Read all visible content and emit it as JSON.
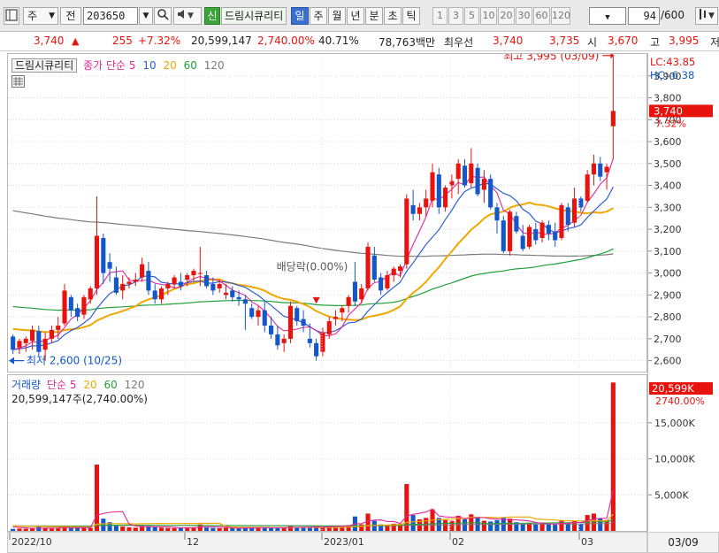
{
  "toolbar": {
    "period_select": "주",
    "prev_label": "전",
    "code": "203650",
    "new_badge": "신",
    "stock_name": "드림시큐리티",
    "tabs": [
      "일",
      "주",
      "월",
      "년",
      "분",
      "초",
      "틱"
    ],
    "active_tab": "일",
    "intervals": [
      "1",
      "3",
      "5",
      "10",
      "20",
      "30",
      "60",
      "120"
    ],
    "count": "94",
    "count_total": "/600"
  },
  "quote": {
    "price": "3,740",
    "change_arrow": "▲",
    "change": "255",
    "change_pct": "+7.32%",
    "volume": "20,599,147",
    "volume_ratio": "2,740.00%",
    "turnover_pct": "40.71%",
    "trade_value": "78,763백만",
    "priority_label": "최우선",
    "ask": "3,740",
    "bid": "3,735",
    "open_label": "시",
    "open": "3,670",
    "high_label": "고",
    "high": "3,995",
    "cut_label": "저"
  },
  "price_legend": {
    "name": "드림시큐리티",
    "ma_title": "종가 단순",
    "ma_periods": [
      "5",
      "10",
      "20",
      "60",
      "120"
    ]
  },
  "volume_legend": {
    "name": "거래량",
    "ma_title": "단순",
    "ma_periods": [
      "5",
      "20",
      "60",
      "120"
    ],
    "current": "20,599,147주(2,740.00%)"
  },
  "price_axis": {
    "lc": "LC:43.85",
    "hc": "HC:-6.38",
    "current_tag": "3,740",
    "current_pct": "7.32%",
    "ticks": [
      "3,900",
      "3,800",
      "3,700",
      "3,600",
      "3,500",
      "3,400",
      "3,300",
      "3,200",
      "3,100",
      "3,000",
      "2,900",
      "2,800",
      "2,700",
      "2,600"
    ]
  },
  "volume_axis": {
    "current_tag": "20,599K",
    "current_pct": "2740.00%",
    "ticks": [
      "15,000K",
      "10,000K",
      "5,000K"
    ]
  },
  "x_axis": {
    "labels": [
      "2022/10",
      "12",
      "2023/01",
      "02",
      "03"
    ],
    "current_date": "03/09"
  },
  "annotations": {
    "high": "최고 3,995 (03/09)",
    "low": "최저 2,600 (10/25)",
    "dividend": "배당락(0.00%)"
  },
  "colors": {
    "up": "#e8130d",
    "down": "#1357c9",
    "ma5": "#e0289a",
    "ma10": "#2e5fd0",
    "ma20": "#f0a800",
    "ma60": "#22a03a",
    "ma120": "#7b7b7b",
    "vma5": "#e0289a",
    "vma20": "#f0a800",
    "vma60": "#22a03a",
    "vma120": "#7b7b7b"
  },
  "chart_data": {
    "type": "candlestick",
    "ylim": [
      2550,
      4000
    ],
    "volume_ylim": [
      0,
      21000
    ],
    "volume_unit": "K shares",
    "ohlc": [
      [
        2710,
        2720,
        2630,
        2650
      ],
      [
        2660,
        2700,
        2630,
        2690
      ],
      [
        2680,
        2710,
        2640,
        2700
      ],
      [
        2690,
        2760,
        2650,
        2740
      ],
      [
        2735,
        2760,
        2620,
        2640
      ],
      [
        2650,
        2730,
        2600,
        2700
      ],
      [
        2700,
        2760,
        2680,
        2740
      ],
      [
        2740,
        2800,
        2700,
        2760
      ],
      [
        2770,
        2950,
        2760,
        2920
      ],
      [
        2890,
        2900,
        2800,
        2830
      ],
      [
        2840,
        2860,
        2780,
        2800
      ],
      [
        2810,
        2900,
        2790,
        2890
      ],
      [
        2880,
        2940,
        2860,
        2930
      ],
      [
        2930,
        3350,
        2900,
        3170
      ],
      [
        3160,
        3180,
        2950,
        3000
      ],
      [
        3050,
        3090,
        2960,
        3020
      ],
      [
        2980,
        3030,
        2900,
        2910
      ],
      [
        2920,
        2990,
        2880,
        2950
      ],
      [
        2950,
        2980,
        2930,
        2960
      ],
      [
        2960,
        3000,
        2940,
        2970
      ],
      [
        2980,
        3070,
        2960,
        3040
      ],
      [
        3010,
        3050,
        2900,
        2920
      ],
      [
        2920,
        2950,
        2860,
        2880
      ],
      [
        2880,
        2940,
        2860,
        2930
      ],
      [
        2930,
        2960,
        2900,
        2950
      ],
      [
        2950,
        2990,
        2930,
        2980
      ],
      [
        2960,
        3000,
        2920,
        2940
      ],
      [
        2970,
        3000,
        2940,
        2990
      ],
      [
        2990,
        3020,
        2960,
        3010
      ],
      [
        3000,
        3120,
        2940,
        3000
      ],
      [
        2990,
        3010,
        2930,
        2940
      ],
      [
        2950,
        2980,
        2900,
        2920
      ],
      [
        2930,
        2970,
        2910,
        2950
      ],
      [
        2900,
        2950,
        2880,
        2910
      ],
      [
        2920,
        2940,
        2870,
        2890
      ],
      [
        2890,
        2920,
        2850,
        2880
      ],
      [
        2880,
        2900,
        2740,
        2860
      ],
      [
        2840,
        2860,
        2790,
        2800
      ],
      [
        2800,
        2850,
        2760,
        2830
      ],
      [
        2830,
        2870,
        2730,
        2760
      ],
      [
        2760,
        2800,
        2700,
        2720
      ],
      [
        2720,
        2760,
        2650,
        2670
      ],
      [
        2680,
        2720,
        2640,
        2700
      ],
      [
        2700,
        2870,
        2680,
        2850
      ],
      [
        2840,
        2850,
        2760,
        2780
      ],
      [
        2790,
        2830,
        2730,
        2760
      ],
      [
        2700,
        2770,
        2660,
        2680
      ],
      [
        2680,
        2700,
        2600,
        2620
      ],
      [
        2640,
        2750,
        2620,
        2730
      ],
      [
        2720,
        2800,
        2700,
        2780
      ],
      [
        2790,
        2830,
        2760,
        2800
      ],
      [
        2820,
        2850,
        2780,
        2840
      ],
      [
        2850,
        2900,
        2820,
        2890
      ],
      [
        2960,
        3050,
        2850,
        2870
      ],
      [
        2880,
        2950,
        2860,
        2930
      ],
      [
        2930,
        3140,
        2920,
        3120
      ],
      [
        3080,
        3120,
        2960,
        2970
      ],
      [
        2980,
        3000,
        2900,
        2920
      ],
      [
        2930,
        3010,
        2920,
        2990
      ],
      [
        2990,
        3030,
        2960,
        3020
      ],
      [
        3010,
        3040,
        2980,
        3030
      ],
      [
        3040,
        3360,
        3020,
        3340
      ],
      [
        3310,
        3380,
        3240,
        3270
      ],
      [
        3270,
        3320,
        3240,
        3300
      ],
      [
        3300,
        3380,
        3260,
        3340
      ],
      [
        3330,
        3500,
        3300,
        3460
      ],
      [
        3450,
        3480,
        3270,
        3300
      ],
      [
        3300,
        3400,
        3280,
        3390
      ],
      [
        3400,
        3450,
        3340,
        3420
      ],
      [
        3430,
        3520,
        3360,
        3500
      ],
      [
        3490,
        3520,
        3390,
        3400
      ],
      [
        3410,
        3570,
        3390,
        3500
      ],
      [
        3480,
        3500,
        3350,
        3360
      ],
      [
        3380,
        3470,
        3320,
        3430
      ],
      [
        3430,
        3450,
        3290,
        3300
      ],
      [
        3300,
        3320,
        3180,
        3240
      ],
      [
        3240,
        3260,
        3090,
        3100
      ],
      [
        3100,
        3290,
        3080,
        3280
      ],
      [
        3260,
        3280,
        3180,
        3190
      ],
      [
        3170,
        3220,
        3100,
        3110
      ],
      [
        3120,
        3220,
        3110,
        3210
      ],
      [
        3200,
        3230,
        3130,
        3150
      ],
      [
        3160,
        3240,
        3140,
        3230
      ],
      [
        3220,
        3240,
        3150,
        3180
      ],
      [
        3190,
        3230,
        3120,
        3150
      ],
      [
        3160,
        3320,
        3150,
        3310
      ],
      [
        3300,
        3320,
        3190,
        3220
      ],
      [
        3230,
        3390,
        3210,
        3340
      ],
      [
        3340,
        3350,
        3280,
        3300
      ],
      [
        3330,
        3470,
        3320,
        3450
      ],
      [
        3450,
        3540,
        3400,
        3500
      ],
      [
        3500,
        3530,
        3420,
        3440
      ],
      [
        3460,
        3500,
        3380,
        3485
      ],
      [
        3670,
        3995,
        3520,
        3740
      ]
    ],
    "volume": [
      280,
      320,
      300,
      350,
      600,
      380,
      320,
      350,
      600,
      450,
      380,
      400,
      420,
      9200,
      1700,
      1200,
      700,
      600,
      500,
      450,
      700,
      650,
      500,
      450,
      400,
      380,
      420,
      450,
      500,
      900,
      450,
      400,
      380,
      420,
      380,
      350,
      500,
      420,
      400,
      450,
      400,
      450,
      400,
      700,
      500,
      450,
      500,
      550,
      600,
      700,
      650,
      700,
      800,
      2000,
      900,
      2400,
      1400,
      900,
      850,
      1000,
      950,
      6500,
      2200,
      1600,
      1800,
      3000,
      1800,
      1500,
      1400,
      2100,
      1600,
      2300,
      1800,
      1400,
      1300,
      1500,
      1900,
      1700,
      1200,
      1000,
      1100,
      900,
      1000,
      900,
      850,
      1500,
      1100,
      1400,
      1000,
      2200,
      2400,
      1700,
      1500,
      20599
    ],
    "ma_labels": [
      "5",
      "10",
      "20",
      "60",
      "120"
    ],
    "ma120_start": 3290
  }
}
